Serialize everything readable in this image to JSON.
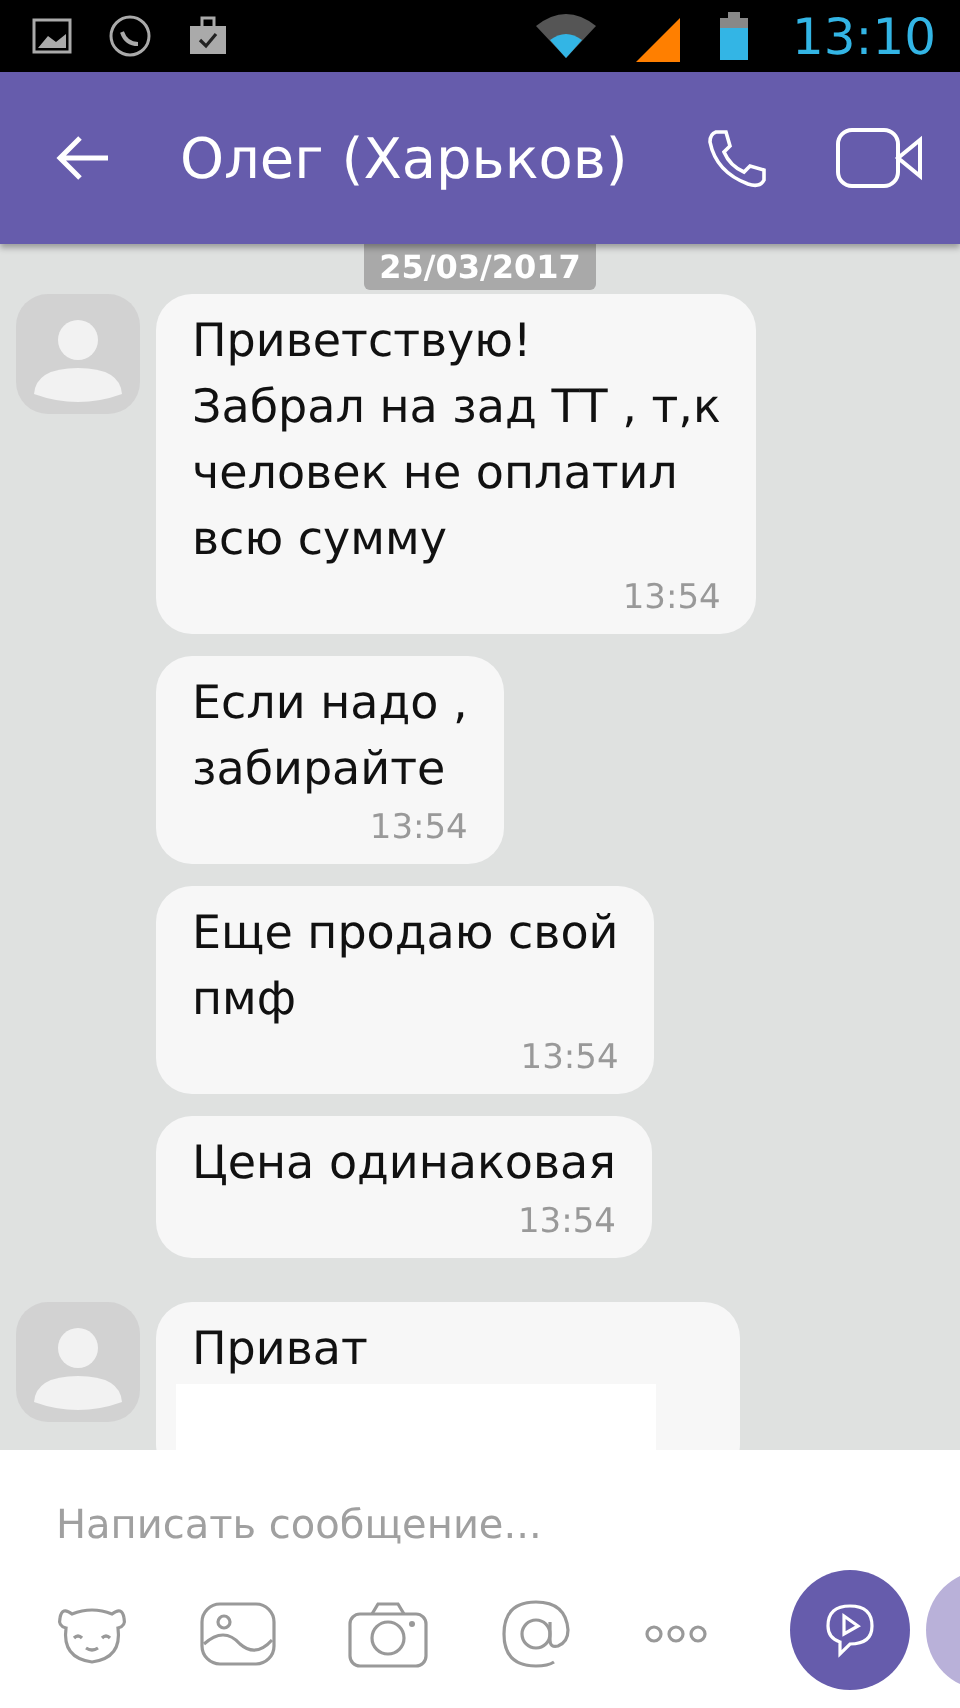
{
  "status_bar": {
    "time": "13:10"
  },
  "header": {
    "title": "Олег (Харьков)"
  },
  "date_chip": "25/03/2017",
  "groups": [
    {
      "messages": [
        {
          "text": "Приветствую!\nЗабрал на зад ТТ , т,к\nчеловек не оплатил\nвсю сумму",
          "time": "13:54"
        },
        {
          "text": "Если надо ,\nзабирайте",
          "time": "13:54"
        },
        {
          "text": "Еще продаю свой\nпмф",
          "time": "13:54"
        },
        {
          "text": "Цена одинаковая",
          "time": "13:54"
        }
      ]
    },
    {
      "messages": [
        {
          "text": "Приват",
          "redacted": true
        }
      ]
    }
  ],
  "composer": {
    "placeholder": "Написать сообщение..."
  }
}
